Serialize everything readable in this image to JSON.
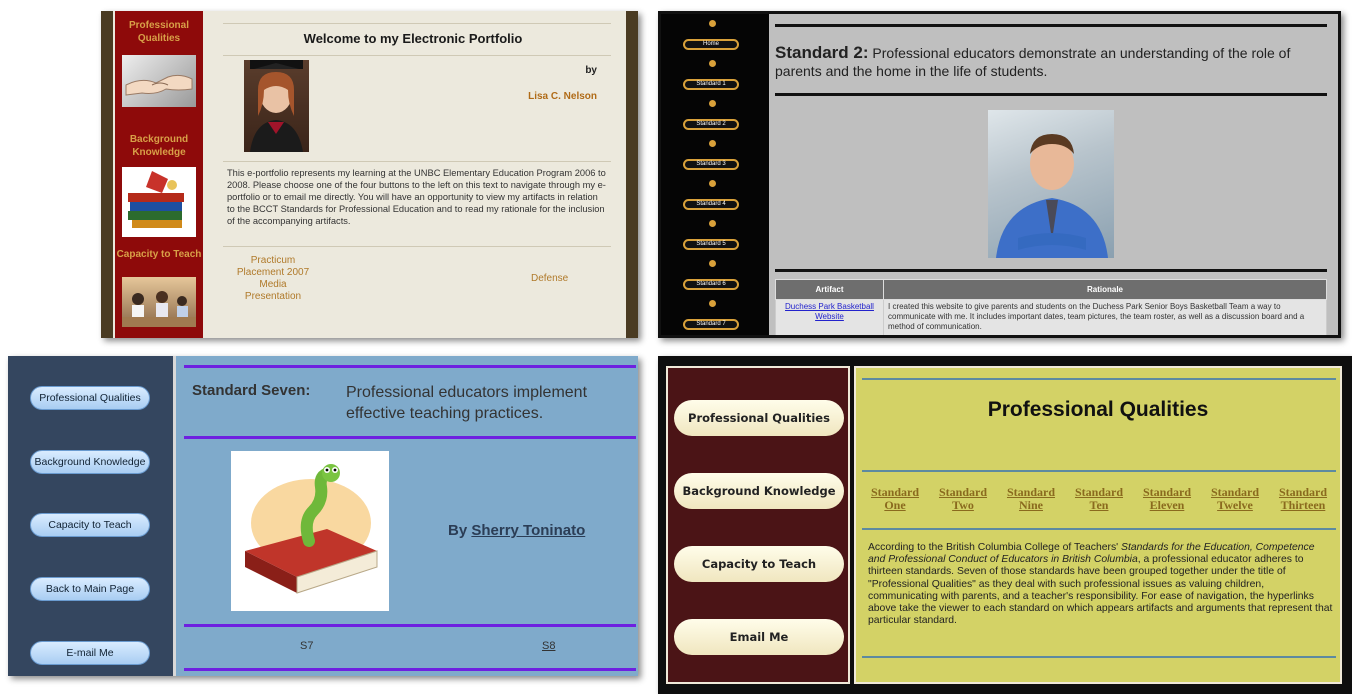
{
  "panel1": {
    "sidebar": {
      "items": [
        "Professional Qualities",
        "Background Knowledge",
        "Capacity to Teach"
      ]
    },
    "title": "Welcome to my Electronic Portfolio",
    "by": "by",
    "author": "Lisa C. Nelson",
    "body": "This e-portfolio represents my learning at the UNBC Elementary Education Program 2006 to 2008. Please choose one of the four buttons to the left on this text to navigate through my e-portfolio or to email me directly. You will have an opportunity to view my artifacts in relation to the BCCT Standards for Professional Education and to read my rationale for the inclusion of the accompanying artifacts.",
    "link_practicum": "Practicum Placement 2007 Media Presentation",
    "link_defense": "Defense"
  },
  "panel2": {
    "nav": [
      "Home",
      "Standard 1",
      "Standard 2",
      "Standard 3",
      "Standard 4",
      "Standard 5",
      "Standard 6",
      "Standard 7"
    ],
    "standard_label": "Standard 2:",
    "standard_text": "Professional educators demonstrate an understanding of the role of parents and the home in the life of students.",
    "table": {
      "headers": [
        "Artifact",
        "Rationale"
      ],
      "artifact": "Duchess Park Basketball Website",
      "rationale": "I created this website to give parents and students on the Duchess Park Senior Boys Basketball Team a way to communicate with me. It includes important dates, team pictures, the team roster, as well as a discussion board and a method of communication."
    }
  },
  "panel3": {
    "buttons": [
      "Professional Qualities",
      "Background Knowledge",
      "Capacity to Teach",
      "Back to Main Page",
      "E-mail Me"
    ],
    "standard_label": "Standard Seven:",
    "standard_text": "Professional educators implement effective teaching practices.",
    "by": "By",
    "author": "Sherry Toninato",
    "link_s7": "S7",
    "link_s8": "S8"
  },
  "panel4": {
    "buttons": [
      "Professional Qualities",
      "Background Knowledge",
      "Capacity to Teach",
      "Email Me"
    ],
    "title": "Professional Qualities",
    "links": [
      "Standard One",
      "Standard Two",
      "Standard Nine",
      "Standard Ten",
      "Standard Eleven",
      "Standard Twelve",
      "Standard Thirteen"
    ],
    "body_intro": "According to the British Columbia College of Teachers' ",
    "body_italic": "Standards for the Education, Competence and Professional Conduct of Educators in British Columbia",
    "body_rest": ", a professional educator adheres to thirteen standards. Seven of those standards have been grouped together under the title of \"Professional Qualities\" as they deal with such professional issues as valuing children, communicating with parents, and a teacher's responsibility. For ease of navigation, the hyperlinks above take the viewer to each standard on which appears artifacts and arguments that represent that particular standard."
  }
}
